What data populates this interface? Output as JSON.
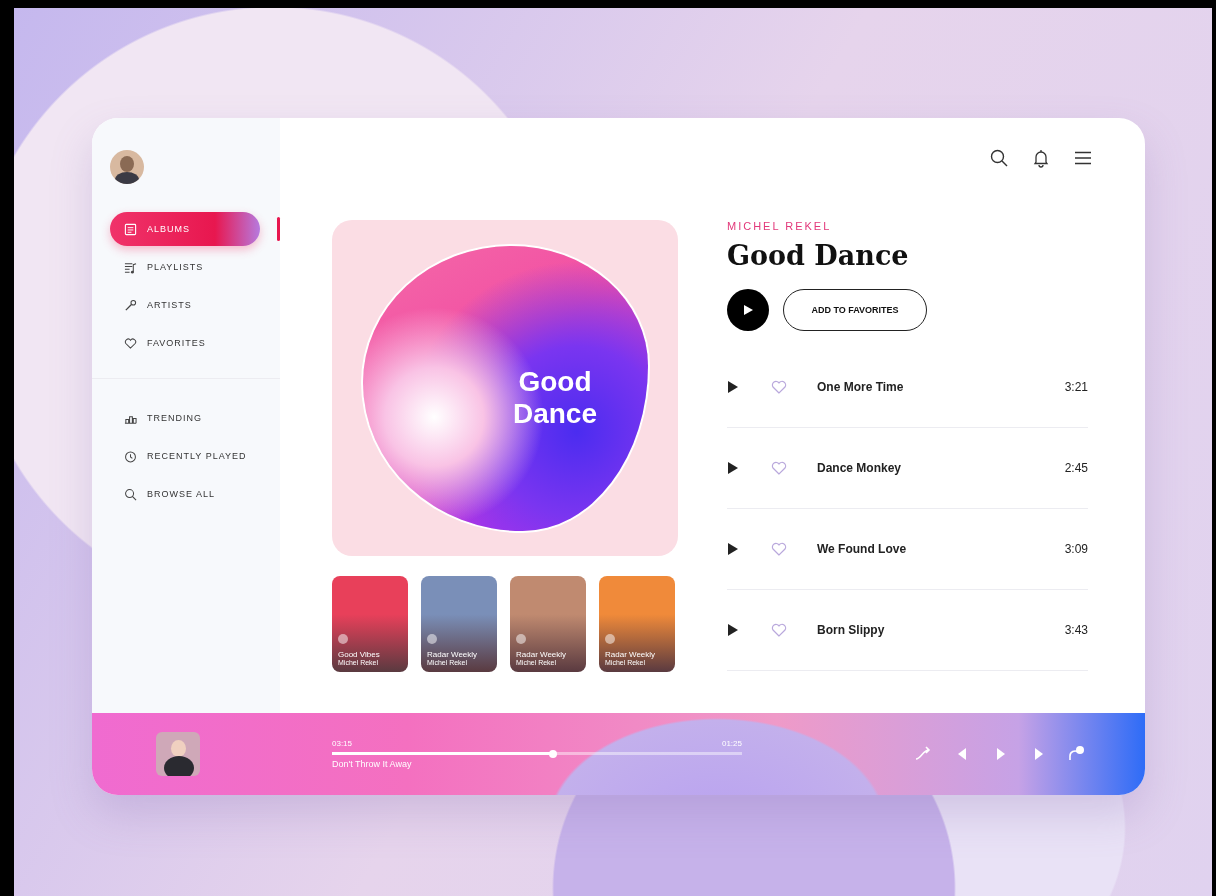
{
  "sidebar": {
    "nav_groups": [
      [
        {
          "label": "ALBUMS",
          "selected": true
        },
        {
          "label": "PLAYLISTS",
          "selected": false
        },
        {
          "label": "ARTISTS",
          "selected": false
        },
        {
          "label": "FAVORITES",
          "selected": false
        }
      ],
      [
        {
          "label": "TRENDING",
          "selected": false
        },
        {
          "label": "RECENTLY PLAYED",
          "selected": false
        },
        {
          "label": "BROWSE ALL",
          "selected": false
        }
      ]
    ]
  },
  "album": {
    "cover_title": "Good Dance",
    "artist": "MICHEL REKEL",
    "title": "Good Dance",
    "favorite_button": "ADD TO FAVORITES"
  },
  "cards": [
    {
      "title": "Good Vibes",
      "subtitle": "Michel Rekel",
      "color": "#e8405a"
    },
    {
      "title": "Radar Weekly",
      "subtitle": "Michel Rekel",
      "color": "#7a8fb8"
    },
    {
      "title": "Radar Weekly",
      "subtitle": "Michel Rekel",
      "color": "#c08a70"
    },
    {
      "title": "Radar Weekly",
      "subtitle": "Michel Rekel",
      "color": "#f08a3a"
    }
  ],
  "tracks": [
    {
      "title": "One More Time",
      "duration": "3:21"
    },
    {
      "title": "Dance Monkey",
      "duration": "2:45"
    },
    {
      "title": "We Found Love",
      "duration": "3:09"
    },
    {
      "title": "Born Slippy",
      "duration": "3:43"
    }
  ],
  "player": {
    "elapsed": "03:15",
    "remaining": "01:25",
    "level": 0.54,
    "song": "Don't Throw It Away"
  }
}
